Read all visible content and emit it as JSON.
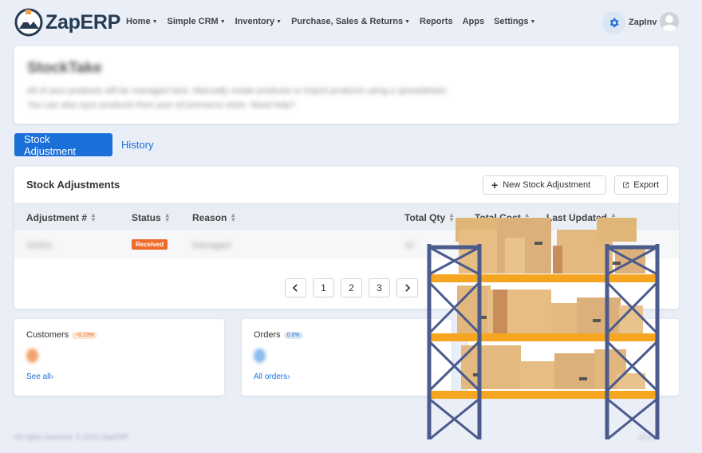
{
  "brand": {
    "name": "ZapERP"
  },
  "nav": {
    "items": [
      {
        "label": "Home",
        "has_dropdown": true
      },
      {
        "label": "Simple CRM",
        "has_dropdown": true
      },
      {
        "label": "Inventory",
        "has_dropdown": true
      },
      {
        "label": "Purchase, Sales & Returns",
        "has_dropdown": true
      },
      {
        "label": "Reports",
        "has_dropdown": false
      },
      {
        "label": "Apps",
        "has_dropdown": false
      },
      {
        "label": "Settings",
        "has_dropdown": true
      }
    ],
    "user_name": "ZapInv"
  },
  "header_card": {
    "title": "StockTake",
    "description": "All of your products will be managed here. Manually create products or import products using a spreadsheet. You can also sync products from your eCommerce store. Need help?"
  },
  "tabs": [
    {
      "label": "Stock Adjustment",
      "active": true
    },
    {
      "label": "History",
      "active": false
    }
  ],
  "table": {
    "title": "Stock Adjustments",
    "new_button": "New Stock Adjustment",
    "export_button": "Export",
    "columns": [
      "Adjustment #",
      "Status",
      "Reason",
      "Total Qty",
      "Total Cost",
      "Last Updated"
    ],
    "rows": [
      {
        "id": "SA001",
        "status": "Received",
        "reason": "Damaged",
        "qty": "10"
      }
    ],
    "pagination": [
      "1",
      "2",
      "3"
    ]
  },
  "stats": [
    {
      "title": "Customers",
      "change": "−0.23%",
      "link": "See all"
    },
    {
      "title": "Orders",
      "change": "0.0%",
      "link": "All orders"
    }
  ],
  "footer": {
    "left": "All rights reserved. © 2024 ZapERP",
    "right": "v2.0.1"
  },
  "colors": {
    "primary": "#1a6fd9",
    "badge_received": "#ee6a2b",
    "background": "#e9eef7"
  }
}
